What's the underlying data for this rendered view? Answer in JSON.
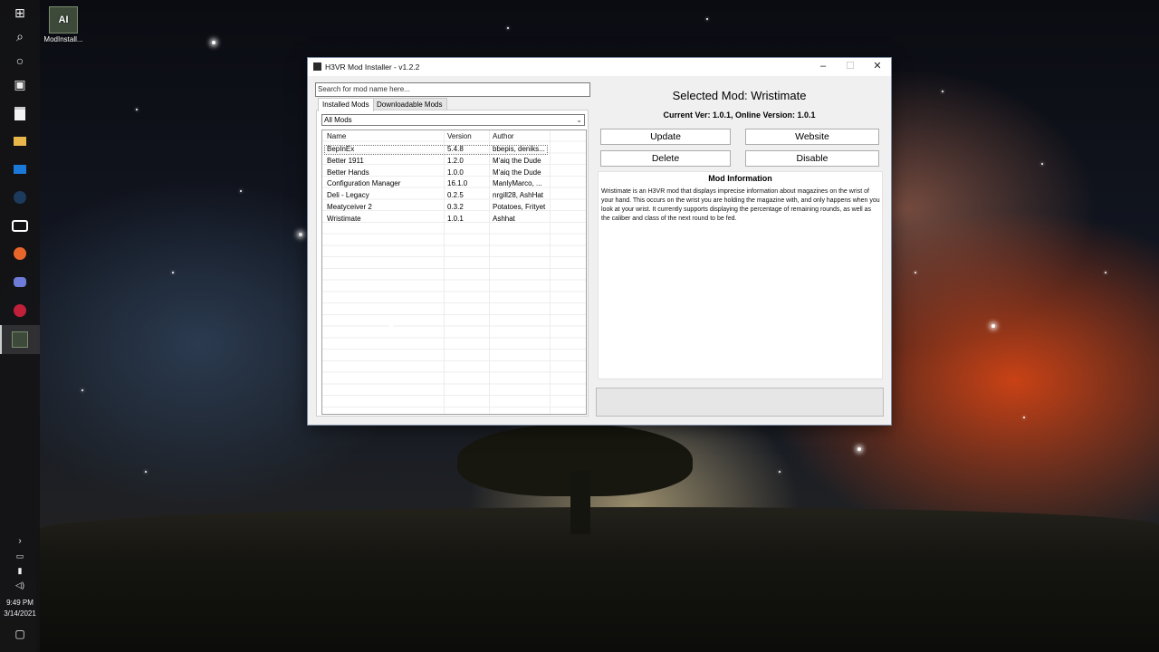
{
  "desktop": {
    "icon_label": "ModInstall...",
    "icon_glyph": "AI"
  },
  "taskbar": {
    "time": "9:49 PM",
    "date": "3/14/2021",
    "icons": [
      "windows-start-icon",
      "search-icon",
      "cortana-icon",
      "task-view-icon",
      "store-icon",
      "file-explorer-icon",
      "mail-icon",
      "steam-icon",
      "oculus-icon",
      "firefox-icon",
      "discord-icon",
      "r6-icon",
      "mod-installer-icon"
    ]
  },
  "window": {
    "title": "H3VR Mod Installer - v1.2.2",
    "minimize": "–",
    "maximize": "☐",
    "close": "✕"
  },
  "search": {
    "placeholder": "Search for mod name here..."
  },
  "tabs": [
    {
      "label": "Installed Mods",
      "active": true
    },
    {
      "label": "Downloadable Mods",
      "active": false
    }
  ],
  "filter": {
    "selected": "All Mods"
  },
  "grid": {
    "columns": [
      "Name",
      "Version",
      "Author"
    ],
    "rows": [
      {
        "name": "BepInEx",
        "version": "5.4.8",
        "author": "bbepis, deniks..."
      },
      {
        "name": "Better 1911",
        "version": "1.2.0",
        "author": "M'aiq the Dude"
      },
      {
        "name": "Better Hands",
        "version": "1.0.0",
        "author": "M'aiq the Dude"
      },
      {
        "name": "Configuration Manager",
        "version": "16.1.0",
        "author": "ManlyMarco, ..."
      },
      {
        "name": "Deli - Legacy",
        "version": "0.2.5",
        "author": "nrgill28, AshHat"
      },
      {
        "name": "Meatyceiver 2",
        "version": "0.3.2",
        "author": "Potatoes, Frityet"
      },
      {
        "name": "Wristimate",
        "version": "1.0.1",
        "author": "Ashhat"
      }
    ]
  },
  "selected_mod": {
    "title": "Selected Mod: Wristimate",
    "version_line": "Current Ver: 1.0.1, Online Version: 1.0.1"
  },
  "buttons": {
    "update": "Update",
    "website": "Website",
    "delete": "Delete",
    "disable": "Disable"
  },
  "info": {
    "title": "Mod Information",
    "text": "Wristimate is an H3VR mod that displays imprecise information about magazines on the wrist of your hand. This occurs on the wrist you are holding the magazine with, and only happens when you look at your wrist. It currently supports displaying the percentage of remaining rounds, as well as the caliber and class of the next round to be fed."
  }
}
